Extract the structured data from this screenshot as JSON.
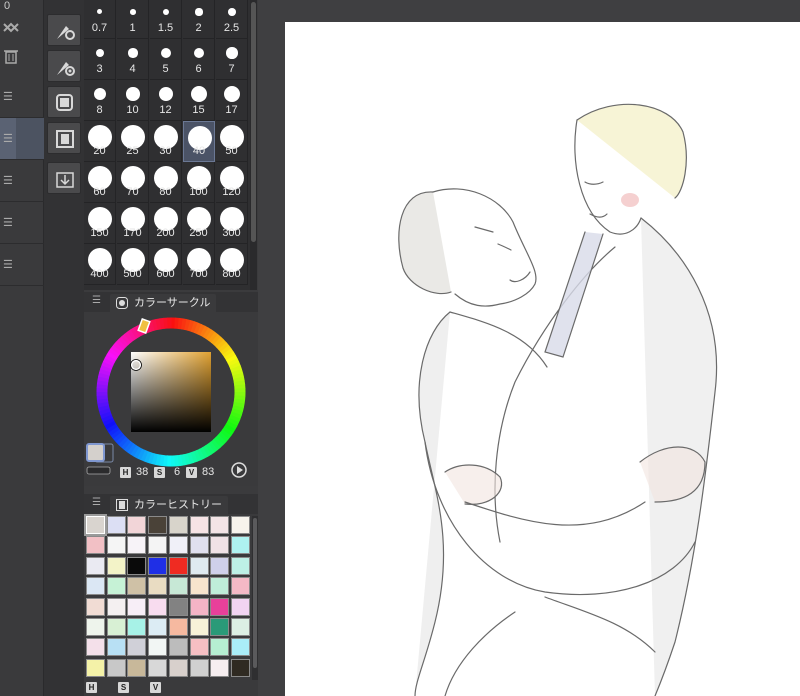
{
  "left_strip": {
    "top_value": "0",
    "icons": [
      "layers-merge-icon",
      "trash-icon"
    ]
  },
  "brush_sizes": [
    "0.7",
    "1",
    "1.5",
    "2",
    "2.5",
    "3",
    "4",
    "5",
    "6",
    "7",
    "8",
    "10",
    "12",
    "15",
    "17",
    "20",
    "25",
    "30",
    "40",
    "50",
    "60",
    "70",
    "80",
    "100",
    "120",
    "150",
    "170",
    "200",
    "250",
    "300",
    "400",
    "500",
    "600",
    "700",
    "800"
  ],
  "selected_brush_size": "40",
  "color_circle": {
    "tab_label": "カラーサークル",
    "h_key": "H",
    "h_value": "38",
    "s_key": "S",
    "s_value": "6",
    "v_key": "V",
    "v_value": "83",
    "main_color": "#d4d0cc",
    "sub_color": "#3a3a3c"
  },
  "color_history": {
    "tab_label": "カラーヒストリー",
    "swatches": [
      "#d9d4cf",
      "#dcdff4",
      "#f2d5d8",
      "#4a4238",
      "#d8d4cb",
      "#f6e3e5",
      "#f3e4e6",
      "#f7f3ec",
      "#f2c0c5",
      "#f5f5f5",
      "#f7f3f8",
      "#f4f4f4",
      "#f0f0f8",
      "#e0e0ef",
      "#f0e2e6",
      "#aef2f0",
      "#eaeaf2",
      "#f3f3c8",
      "#0a0a0a",
      "#1f2fe6",
      "#ef2b22",
      "#dfeaf0",
      "#cfd0ea",
      "#bdf0e6",
      "#dbe7f4",
      "#c6f2d6",
      "#cfc1a6",
      "#e9dcc2",
      "#c7e8d6",
      "#f7e4cd",
      "#bfedd9",
      "#f4b9c6",
      "#f1dcd4",
      "#f4f0f1",
      "#f7eef7",
      "#f8dcef",
      "#828282",
      "#f4b4c6",
      "#e8409a",
      "#f2d4f2",
      "#eef4ec",
      "#d8f0d4",
      "#a7f2e7",
      "#dcecf4",
      "#f6b9a0",
      "#f7f2d8",
      "#2a9a78",
      "#dcefe4",
      "#f4e0ea",
      "#b8e0f4",
      "#d0d0d8",
      "#f2f6f4",
      "#bcbcbc",
      "#f6bfc3",
      "#b6efd2",
      "#aaedf8",
      "#f4f2a8",
      "#c8c8c8",
      "#c8b89a",
      "#d8d8d8",
      "#d8d0cc",
      "#d0d0d0",
      "#f6eef0",
      "#2f2a22"
    ],
    "h_key": "H",
    "s_key": "S",
    "v_key": "V"
  }
}
